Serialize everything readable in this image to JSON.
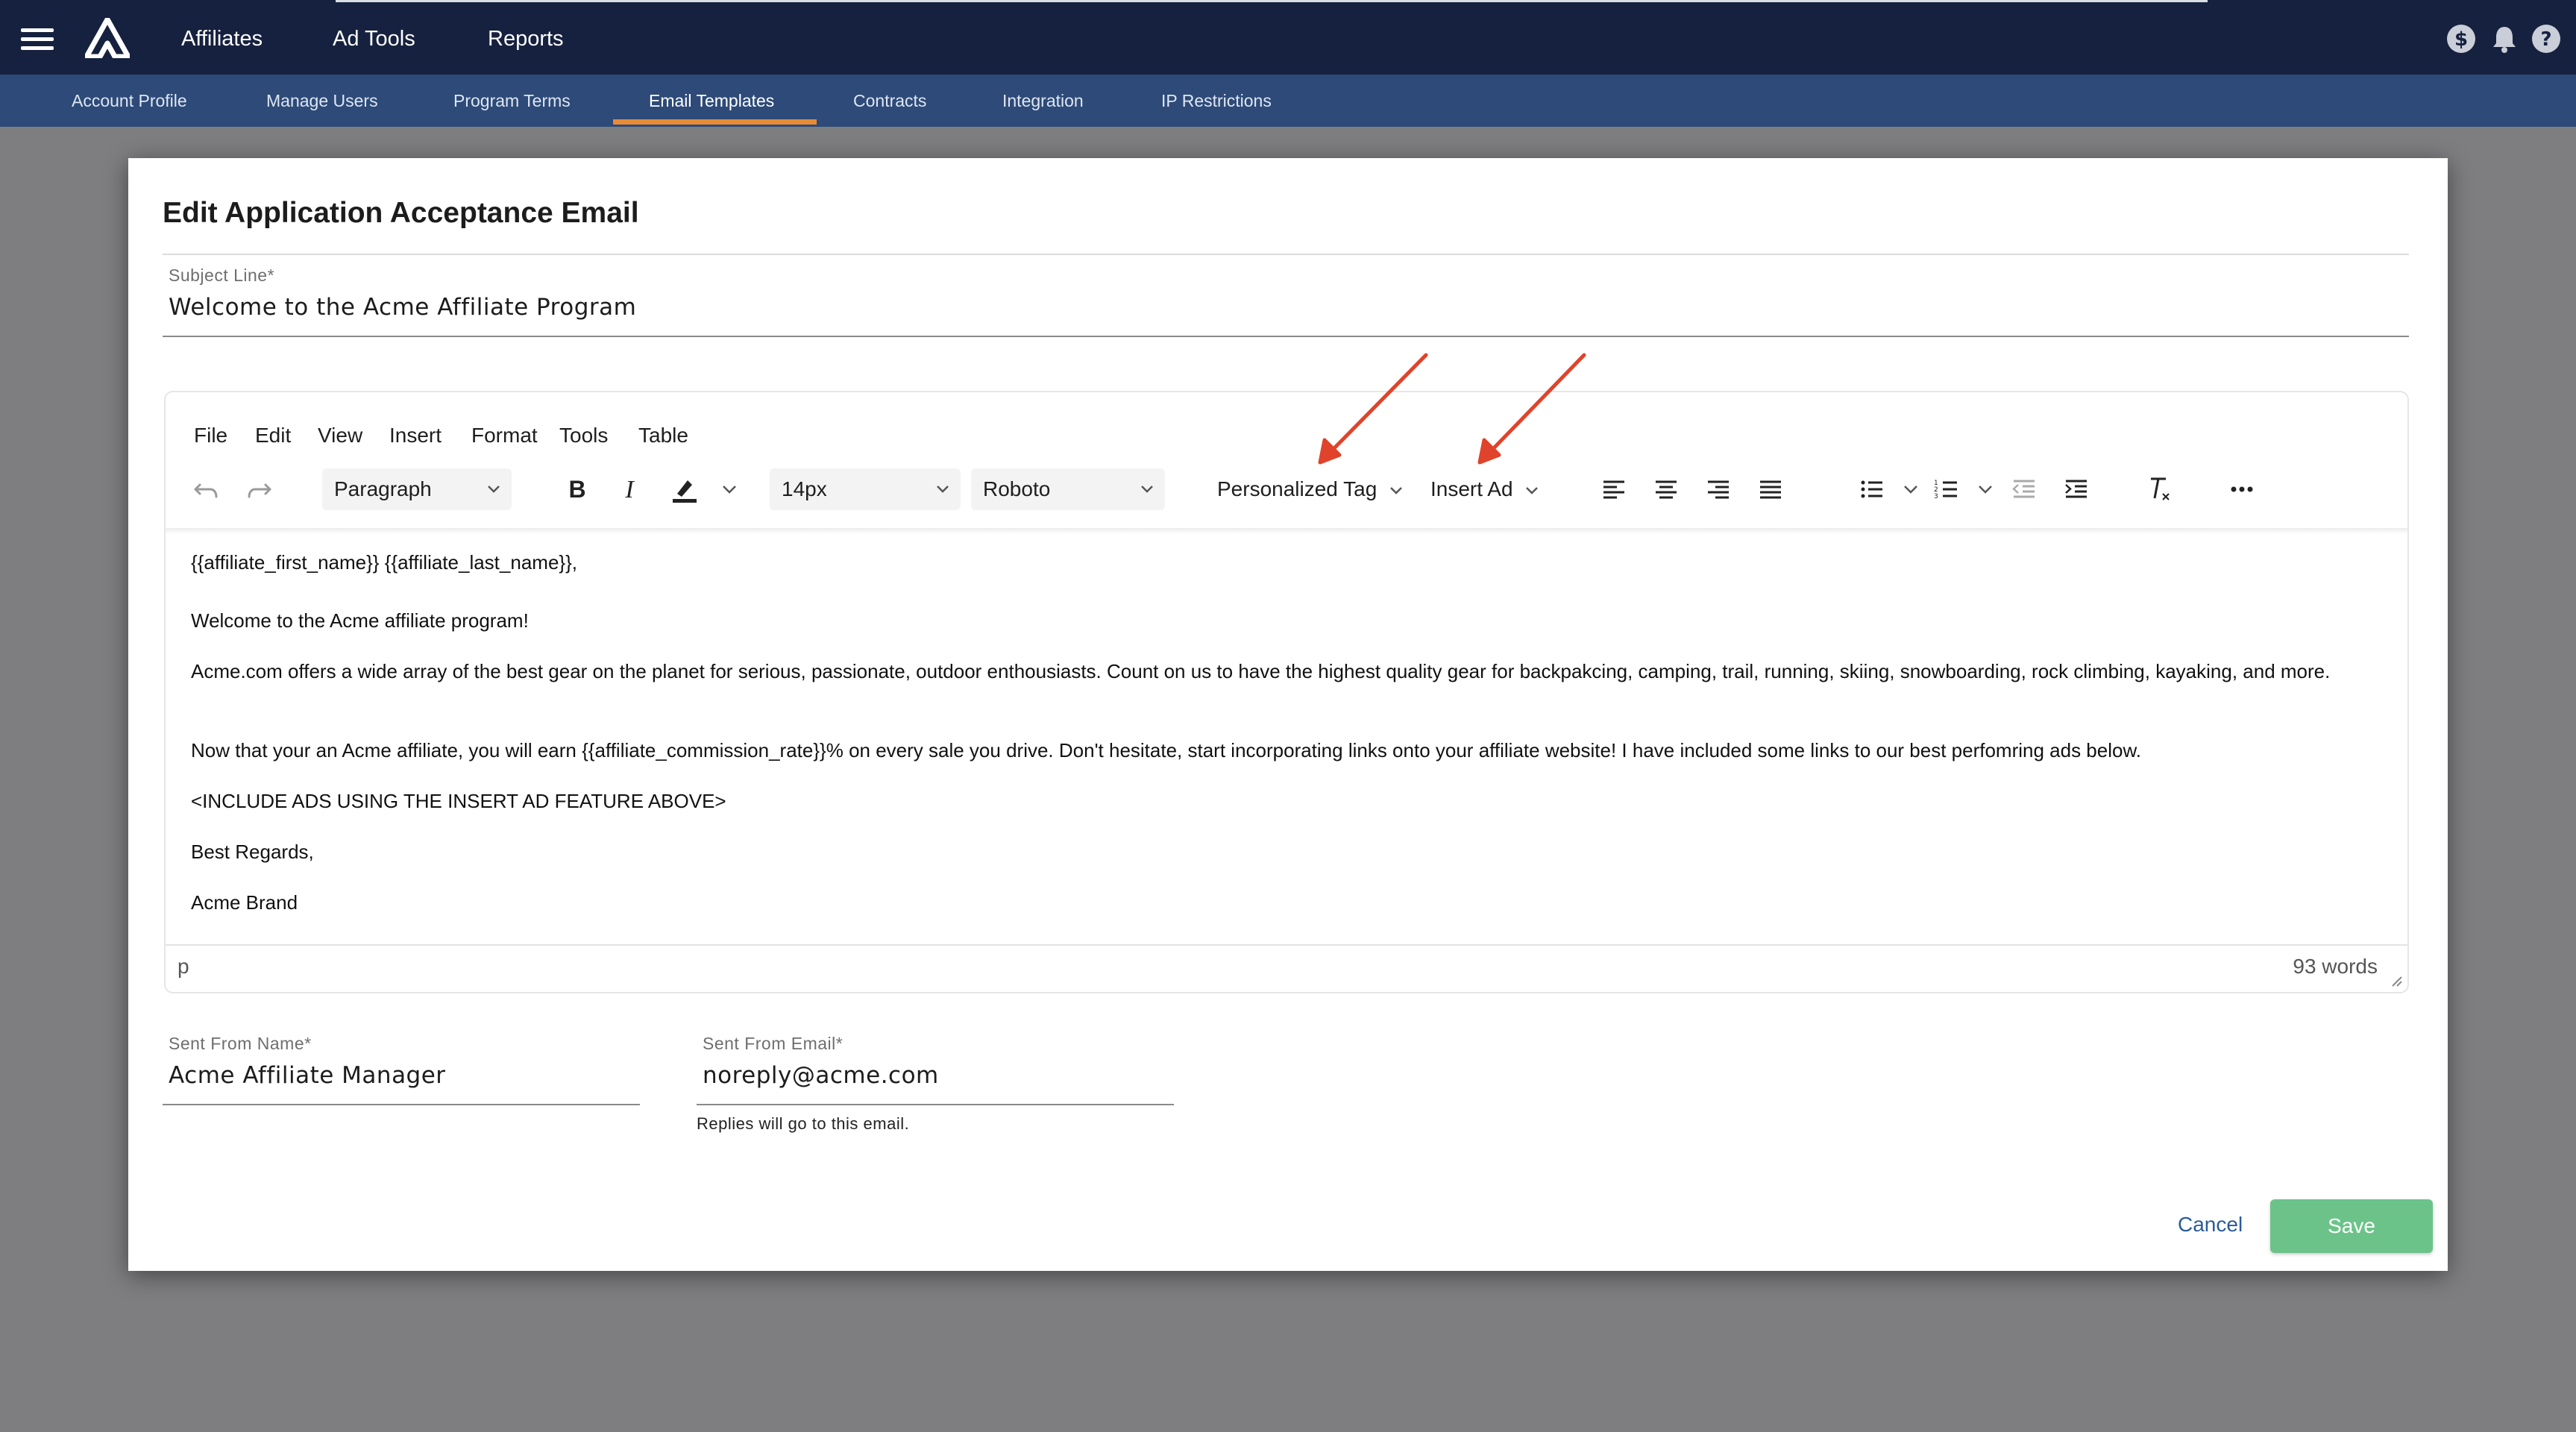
{
  "topnav": {
    "items": [
      {
        "label": "Affiliates"
      },
      {
        "label": "Ad Tools"
      },
      {
        "label": "Reports"
      }
    ],
    "icons": [
      "hamburger-icon",
      "logo-icon",
      "dollar-icon",
      "bell-icon",
      "help-icon"
    ]
  },
  "subnav": {
    "tabs": [
      {
        "label": "Account Profile"
      },
      {
        "label": "Manage Users"
      },
      {
        "label": "Program Terms"
      },
      {
        "label": "Email Templates",
        "active": true
      },
      {
        "label": "Contracts"
      },
      {
        "label": "Integration"
      },
      {
        "label": "IP Restrictions"
      }
    ]
  },
  "modal": {
    "title": "Edit Application Acceptance Email",
    "subject": {
      "label": "Subject Line*",
      "value": "Welcome to the Acme Affiliate Program"
    },
    "editor": {
      "menu": [
        "File",
        "Edit",
        "View",
        "Insert",
        "Format",
        "Tools",
        "Table"
      ],
      "toolbar": {
        "block_format": "Paragraph",
        "font_size": "14px",
        "font_family": "Roboto",
        "personalized_tag": "Personalized Tag",
        "insert_ad": "Insert Ad"
      },
      "content": [
        "{{affiliate_first_name}} {{affiliate_last_name}},",
        "Welcome to the Acme affiliate program!",
        "Acme.com offers a wide array of the best gear on the planet for serious, passionate, outdoor enthousiasts.  Count on us to have the highest quality gear for backpakcing, camping, trail, running, skiing, snowboarding, rock climbing, kayaking, and more.",
        "Now that your an Acme affiliate, you will earn {{affiliate_commission_rate}}%  on every sale you drive.  Don't hesitate, start incorporating links onto your affiliate website!  I have included some links to our best perfomring ads below.",
        "<INCLUDE ADS USING THE INSERT AD FEATURE ABOVE>",
        "Best Regards,",
        "Acme Brand"
      ],
      "status_path": "p",
      "word_count": "93 words"
    },
    "sent_from_name": {
      "label": "Sent From Name*",
      "value": "Acme Affiliate Manager"
    },
    "sent_from_email": {
      "label": "Sent From Email*",
      "value": "noreply@acme.com",
      "helper": "Replies will go to this email."
    },
    "cancel_label": "Cancel",
    "save_label": "Save"
  },
  "colors": {
    "topbar": "#16213f",
    "subbar": "#2d4a78",
    "active_tab_underline": "#e98b35",
    "save_button": "#6cc38a",
    "cancel_link": "#2a5c99",
    "annotation_arrow": "#e0432b"
  }
}
